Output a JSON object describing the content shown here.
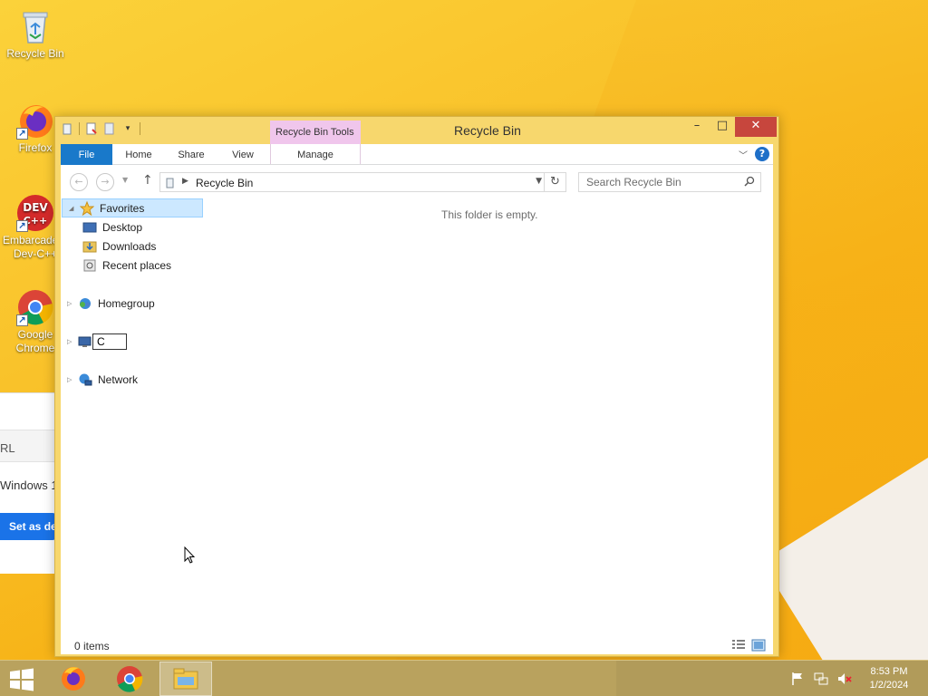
{
  "desktop": {
    "icons": [
      {
        "label": "Recycle Bin",
        "name": "recycle-bin"
      },
      {
        "label": "Firefox",
        "name": "firefox"
      },
      {
        "label": "Embarcadero Dev-C++",
        "name": "dev-cpp"
      },
      {
        "label": "Google Chrome",
        "name": "google-chrome"
      }
    ]
  },
  "background_app": {
    "url_fragment": "RL",
    "text_fragment": "Windows 1",
    "button_fragment": "Set as de"
  },
  "window": {
    "title": "Recycle Bin",
    "context_tab_group": "Recycle Bin Tools",
    "ribbon_tabs": {
      "file": "File",
      "home": "Home",
      "share": "Share",
      "view": "View",
      "manage": "Manage"
    },
    "address": {
      "path": "Recycle Bin"
    },
    "search": {
      "placeholder": "Search Recycle Bin"
    },
    "nav_pane": {
      "favorites": "Favorites",
      "desktop": "Desktop",
      "downloads": "Downloads",
      "recent_places": "Recent places",
      "homegroup": "Homegroup",
      "rename_value": "C",
      "network": "Network"
    },
    "empty_message": "This folder is empty.",
    "status": {
      "item_count": "0 items"
    }
  },
  "taskbar": {
    "time": "8:53 PM",
    "date": "1/2/2024"
  },
  "colors": {
    "file_tab": "#1979ca",
    "context_tab": "#f0c6ec",
    "close_button": "#c7463d",
    "selection": "#cce8ff"
  }
}
